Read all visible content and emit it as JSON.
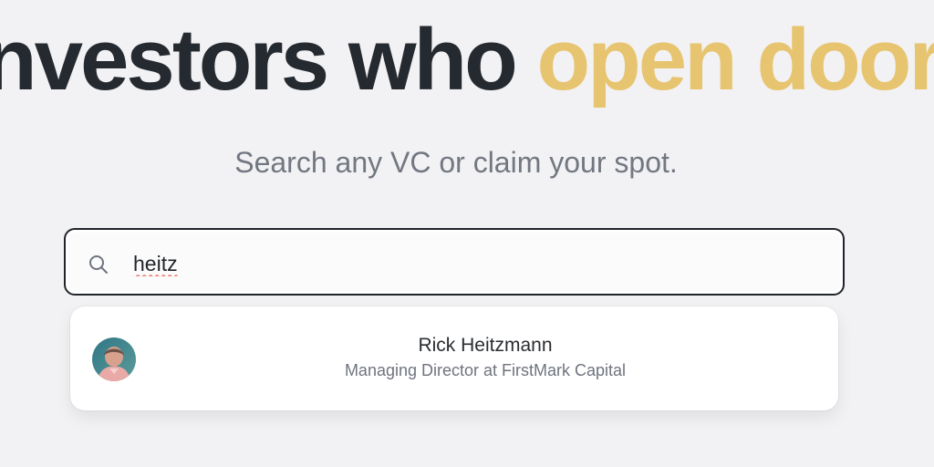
{
  "hero": {
    "title_main": "nvestors who ",
    "title_accent": "open doors"
  },
  "subtitle": "Search any VC or claim your spot.",
  "search": {
    "value": "heitz",
    "icon": "search-icon"
  },
  "results": [
    {
      "name": "Rick Heitzmann",
      "role": "Managing Director at FirstMark Capital"
    }
  ],
  "colors": {
    "background": "#f2f2f4",
    "title": "#252a31",
    "accent": "#e7c46f",
    "subtitle": "#727781",
    "search_border": "#21252a",
    "spellcheck": "#e24c3c"
  }
}
